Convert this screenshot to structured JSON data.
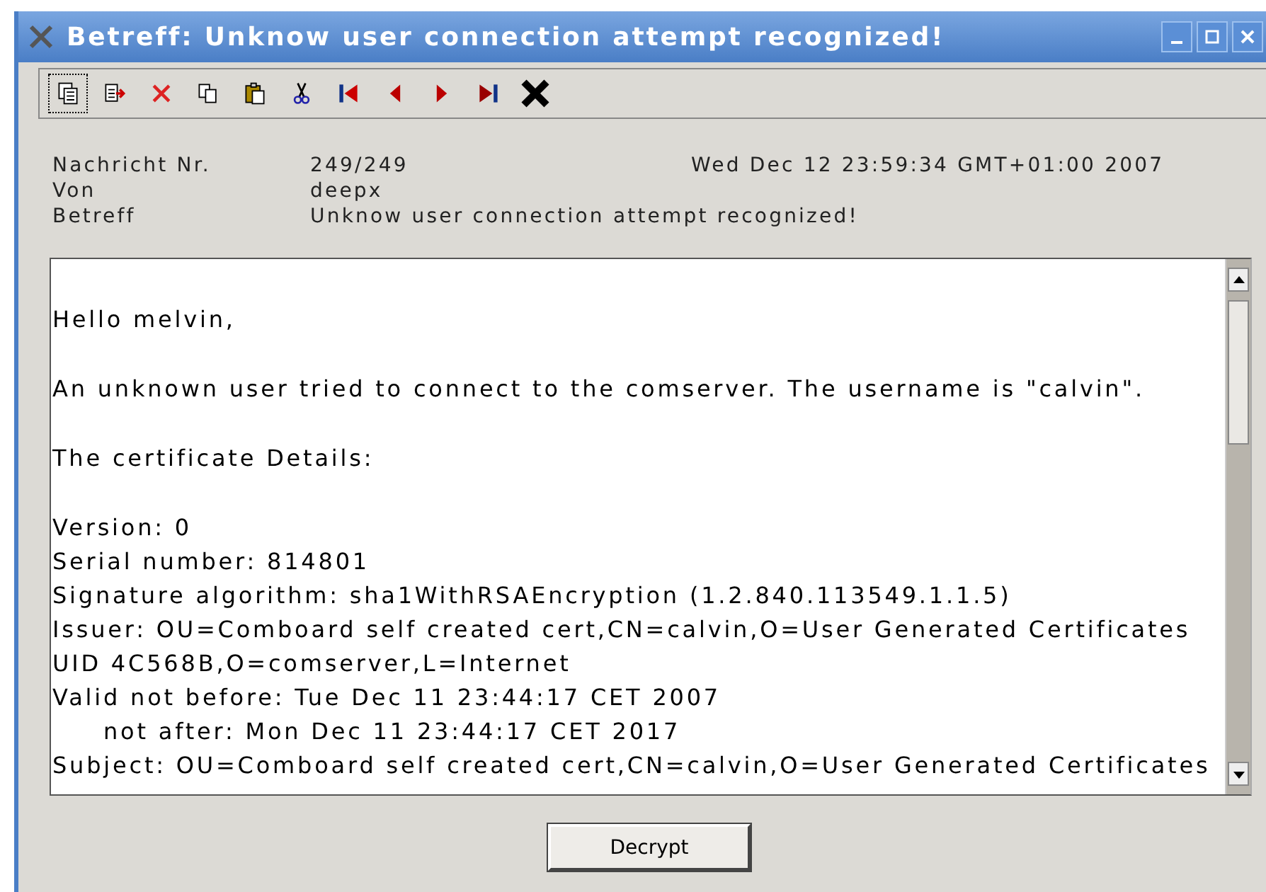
{
  "window": {
    "title": "Betreff: Unknow user connection attempt recognized!"
  },
  "header": [
    {
      "label": "Nachricht Nr.",
      "value": "249/249",
      "extra": "Wed Dec 12 23:59:34 GMT+01:00 2007"
    },
    {
      "label": "Von",
      "value": "deepx"
    },
    {
      "label": "Betreff",
      "value": "Unknow user connection attempt recognized!"
    }
  ],
  "message": [
    {
      "kind": "paragraph",
      "text": "Hello melvin,"
    },
    {
      "kind": "paragraph",
      "text": "An unknown user tried to connect to the comserver. The username is \"calvin\"."
    },
    {
      "kind": "paragraph",
      "text": "The certificate Details:"
    },
    {
      "kind": "line",
      "text": "Version: 0"
    },
    {
      "kind": "line",
      "text": "Serial number: 814801"
    },
    {
      "kind": "line",
      "text": "Signature algorithm: sha1WithRSAEncryption (1.2.840.113549.1.1.5)"
    },
    {
      "kind": "line",
      "text": "Issuer: OU=Comboard self created cert,CN=calvin,O=User Generated Certificates"
    },
    {
      "kind": "line",
      "text": "UID 4C568B,O=comserver,L=Internet"
    },
    {
      "kind": "line",
      "text": "Valid not before: Tue Dec 11 23:44:17 CET 2007"
    },
    {
      "kind": "indented",
      "text": "not after: Mon Dec 11 23:44:17 CET 2017"
    },
    {
      "kind": "line",
      "text": "Subject: OU=Comboard self created cert,CN=calvin,O=User Generated Certificates"
    }
  ],
  "buttons": [
    "Decrypt"
  ]
}
